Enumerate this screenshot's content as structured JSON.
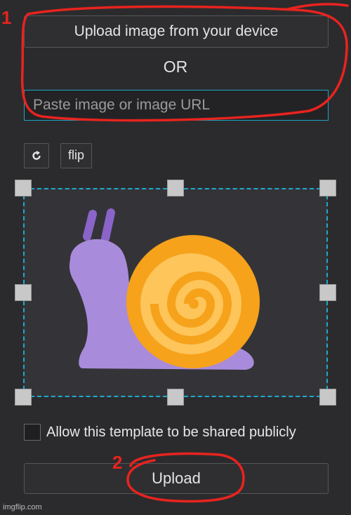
{
  "uploader": {
    "upload_device_label": "Upload image from your device",
    "or_label": "OR",
    "url_placeholder": "Paste image or image URL"
  },
  "toolbar": {
    "rotate_icon": "rotate-icon",
    "flip_label": "flip"
  },
  "preview": {
    "image": "snail-emoji"
  },
  "share": {
    "checked": false,
    "label": "Allow this template to be shared publicly"
  },
  "upload_button_label": "Upload",
  "watermark": "imgflip.com",
  "annotations": {
    "marker_1": "1",
    "marker_2": "2",
    "color": "#e8231f"
  },
  "colors": {
    "background": "#2b2b2d",
    "accent": "#20a8cf"
  }
}
